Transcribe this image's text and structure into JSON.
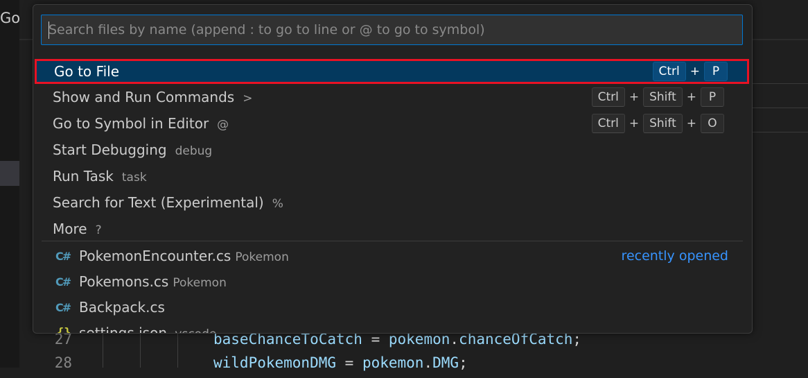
{
  "app": {
    "menu_go": "Go"
  },
  "quick_open": {
    "search_placeholder": "Search files by name (append : to go to line or @ to go to symbol)",
    "commands": [
      {
        "label": "Go to File",
        "hint": "",
        "keys": [
          "Ctrl",
          "P"
        ],
        "active": true
      },
      {
        "label": "Show and Run Commands",
        "hint": ">",
        "keys": [
          "Ctrl",
          "Shift",
          "P"
        ]
      },
      {
        "label": "Go to Symbol in Editor",
        "hint": "@",
        "keys": [
          "Ctrl",
          "Shift",
          "O"
        ]
      },
      {
        "label": "Start Debugging",
        "hint": "debug",
        "keys": []
      },
      {
        "label": "Run Task",
        "hint": "task",
        "keys": []
      },
      {
        "label": "Search for Text (Experimental)",
        "hint": "%",
        "keys": []
      },
      {
        "label": "More",
        "hint": "?",
        "keys": []
      }
    ],
    "key_separator": "+",
    "recent_label": "recently opened",
    "files": [
      {
        "icon": "csharp-file-icon",
        "name": "PokemonEncounter.cs",
        "description": "Pokemon"
      },
      {
        "icon": "csharp-file-icon",
        "name": "Pokemons.cs",
        "description": "Pokemon"
      },
      {
        "icon": "csharp-file-icon",
        "name": "Backpack.cs",
        "description": ""
      },
      {
        "icon": "json-file-icon",
        "name": "settings.json",
        "description": ".vscode"
      }
    ],
    "icon_glyphs": {
      "csharp": "C#",
      "json": "{}"
    }
  },
  "editor": {
    "lines": [
      {
        "number": "27",
        "tokens": [
          {
            "t": "baseChanceToCatch",
            "c": "var"
          },
          {
            "t": " = ",
            "c": "op"
          },
          {
            "t": "pokemon",
            "c": "var"
          },
          {
            "t": ".",
            "c": "op"
          },
          {
            "t": "chanceOfCatch",
            "c": "var"
          },
          {
            "t": ";",
            "c": "op"
          }
        ]
      },
      {
        "number": "28",
        "tokens": [
          {
            "t": "wildPokemonDMG",
            "c": "var"
          },
          {
            "t": " = ",
            "c": "op"
          },
          {
            "t": "pokemon",
            "c": "var"
          },
          {
            "t": ".",
            "c": "op"
          },
          {
            "t": "DMG",
            "c": "var"
          },
          {
            "t": ";",
            "c": "op"
          }
        ]
      }
    ]
  },
  "colors": {
    "accent": "#0078d4",
    "highlight_outline": "#e81224",
    "active_row": "#04395e",
    "link": "#3794ff"
  }
}
